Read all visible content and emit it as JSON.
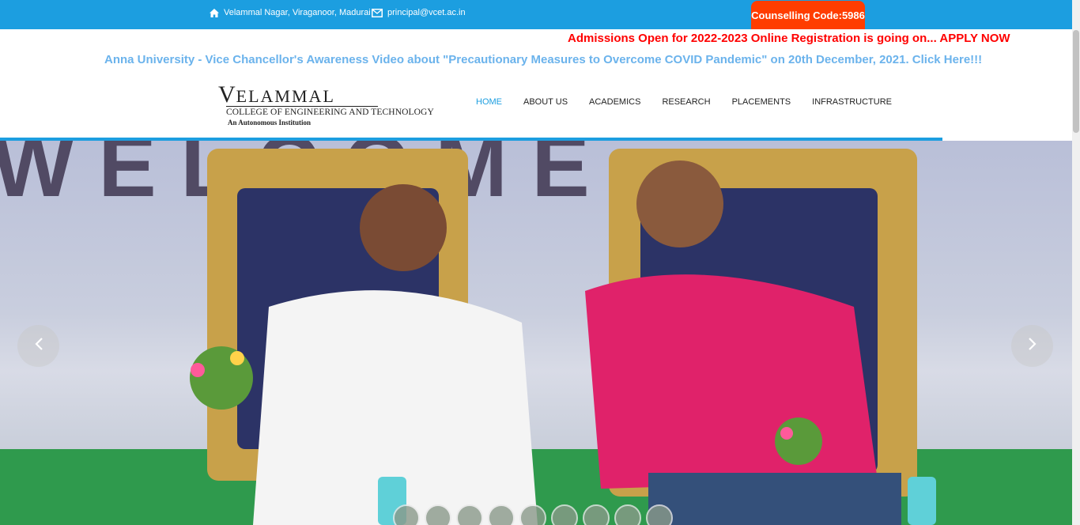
{
  "topbar": {
    "address": "Velammal Nagar, Viraganoor, Madurai",
    "email": "principal@vcet.ac.in",
    "counselling": "Counselling Code:5986",
    "bg_color": "#1c9ee0",
    "counselling_color": "#ff3d00",
    "address_icon": "home-icon",
    "email_icon": "envelope-icon"
  },
  "announcements": {
    "admissions": "Admissions Open for 2022-2023 Online Registration is going on... APPLY NOW",
    "covid": "Anna University - Vice Chancellor's Awareness Video about \"Precautionary Measures to Overcome COVID Pandemic\" on 20th December, 2021. Click Here!!!"
  },
  "logo": {
    "name_first": "V",
    "name_rest": "ELAMMAL",
    "line1": "COLLEGE OF ENGINEERING AND TECHNOLOGY",
    "line2": "An Autonomous Institution"
  },
  "nav": {
    "items": [
      {
        "label": "HOME",
        "active": true
      },
      {
        "label": "ABOUT US",
        "active": false
      },
      {
        "label": "ACADEMICS",
        "active": false
      },
      {
        "label": "RESEARCH",
        "active": false
      },
      {
        "label": "PLACEMENTS",
        "active": false
      },
      {
        "label": "INFRASTRUCTURE",
        "active": false
      }
    ],
    "active_color": "#1c9ee0"
  },
  "slider": {
    "prev_icon": "chevron-left-icon",
    "next_icon": "chevron-right-icon",
    "thumbnail_count": 9
  }
}
